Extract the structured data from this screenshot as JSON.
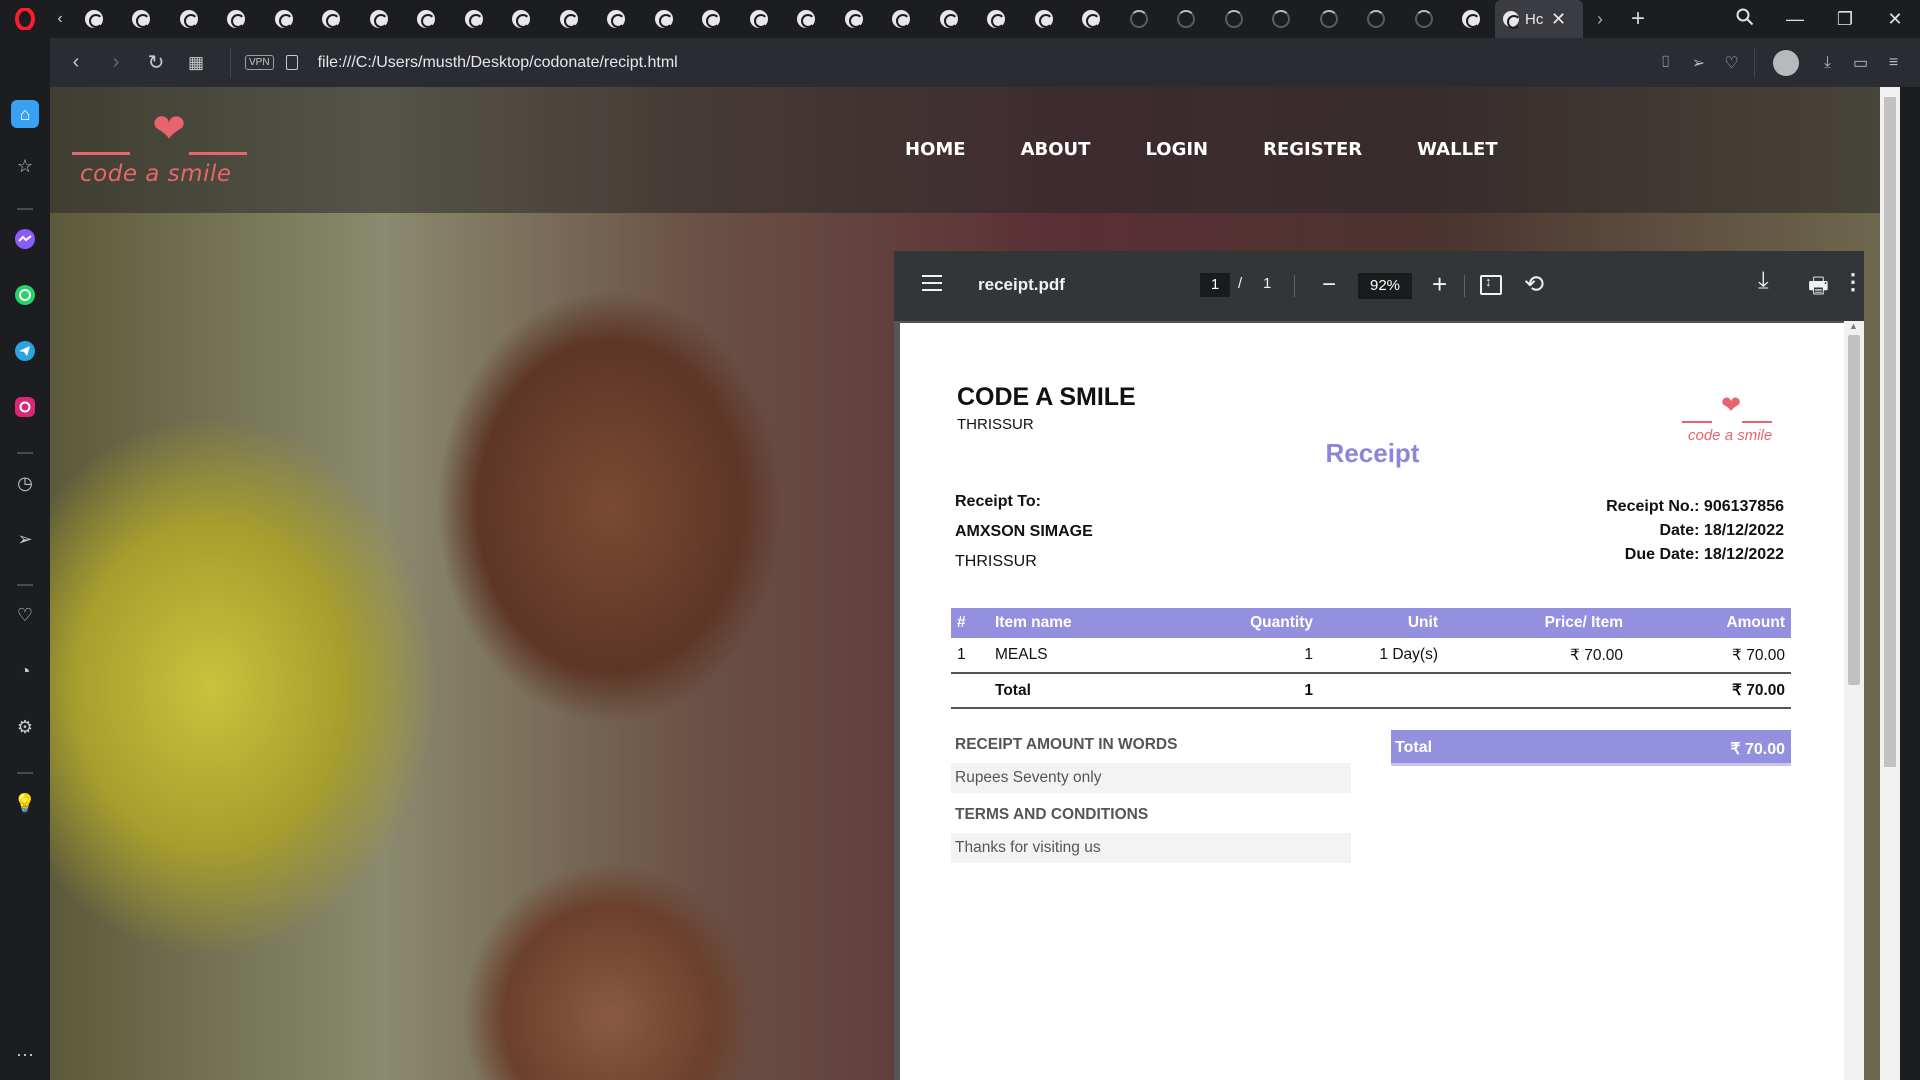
{
  "browser": {
    "tab_count_regular": 23,
    "tab_count_loading": 7,
    "active_tab_title": "Hc",
    "url": "file:///C:/Users/musth/Desktop/codonate/recipt.html",
    "vpn_label": "VPN"
  },
  "site": {
    "brand_name": "code a smile",
    "brand_color": "#e8656f",
    "nav": [
      "HOME",
      "ABOUT",
      "LOGIN",
      "REGISTER",
      "WALLET"
    ]
  },
  "pdf": {
    "filename": "receipt.pdf",
    "current_page": "1",
    "page_separator": "/",
    "total_pages": "1",
    "zoom": "92%"
  },
  "receipt": {
    "company": "CODE A SMILE",
    "company_city": "THRISSUR",
    "logo_text": "code a smile",
    "title": "Receipt",
    "title_color": "#8b86d9",
    "to_label": "Receipt To:",
    "to_name": "AMXSON SIMAGE",
    "to_city": "THRISSUR",
    "receipt_no": "Receipt No.: 906137856",
    "date": "Date: 18/12/2022",
    "due_date": "Due Date: 18/12/2022",
    "table_headers": [
      "#",
      "Item name",
      "Quantity",
      "Unit",
      "Price/ Item",
      "Amount"
    ],
    "items": [
      {
        "no": "1",
        "name": "MEALS",
        "quantity": "1",
        "unit": "1 Day(s)",
        "price": "₹ 70.00",
        "amount": "₹ 70.00"
      }
    ],
    "total_row": {
      "label": "Total",
      "quantity": "1",
      "amount": "₹ 70.00"
    },
    "words_label": "RECEIPT AMOUNT IN WORDS",
    "words_value": "Rupees Seventy only",
    "terms_label": "TERMS AND CONDITIONS",
    "terms_value": "Thanks for visiting us",
    "total_box_label": "Total",
    "total_box_value": "₹ 70.00",
    "accent_color": "#9490e0"
  }
}
